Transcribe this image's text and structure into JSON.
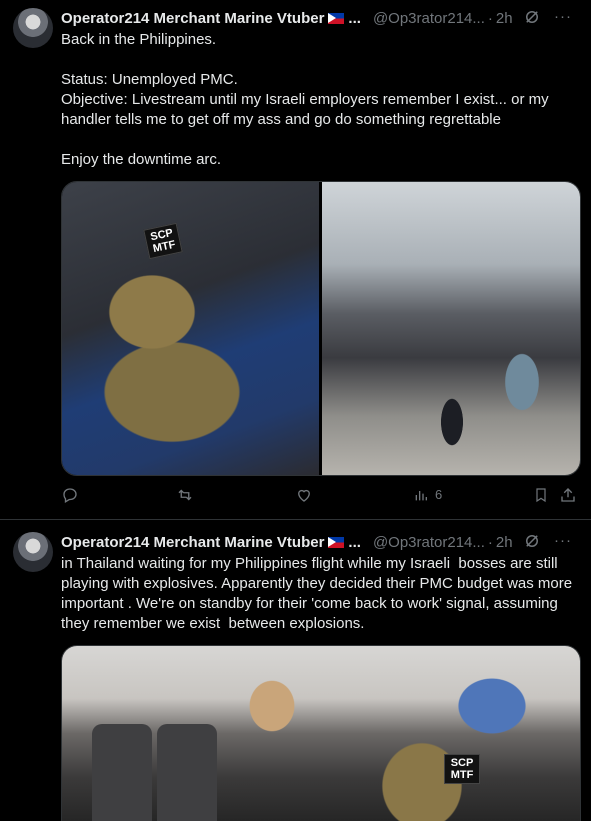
{
  "colors": {
    "background": "#000000",
    "text": "#e7e9ea",
    "muted": "#71767b",
    "divider": "#2f3336"
  },
  "tweets": [
    {
      "author": "Operator214 Merchant Marine Vtuber",
      "author_flag_icon": "philippines-flag-icon",
      "handle": "@Op3rator214...",
      "separator": "·",
      "time": "2h",
      "text": "Back in the Philippines.\n\nStatus: Unemployed PMC.\nObjective: Livestream until my Israeli employers remember I exist... or my handler tells me to get off my ass and go do something regrettable\n\nEnjoy the downtime arc.",
      "photos": [
        {
          "desc_icon": "backpack-on-suitcase-photo",
          "patch_top": "SCP",
          "patch_bottom": "MTF"
        },
        {
          "desc_icon": "airport-terminal-photo"
        }
      ],
      "actions": {
        "reply": "",
        "repost": "",
        "like": "",
        "views": "6"
      }
    },
    {
      "author": "Operator214 Merchant Marine Vtuber",
      "author_flag_icon": "philippines-flag-icon",
      "handle": "@Op3rator214...",
      "separator": "·",
      "time": "2h",
      "text": "in Thailand waiting for my Philippines flight while my Israeli  bosses are still playing with explosives. Apparently they decided their PMC budget was more important . We're on standby for their 'come back to work' signal, assuming they remember we exist  between explosions.",
      "photos": [
        {
          "desc_icon": "airport-waiting-area-photo",
          "patch_top": "SCP",
          "patch_bottom": "MTF"
        }
      ]
    }
  ]
}
